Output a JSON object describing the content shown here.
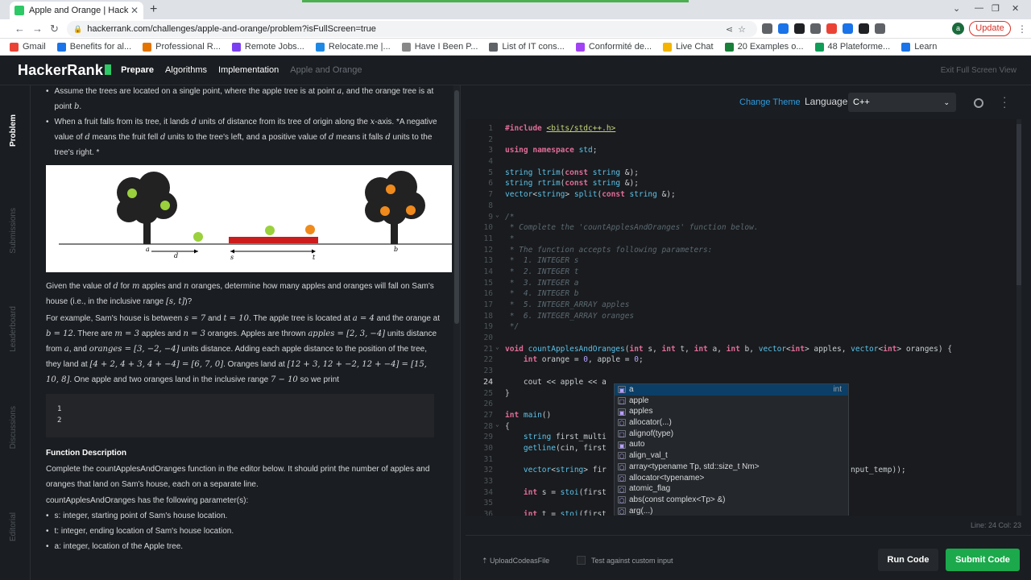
{
  "browser": {
    "tab_title": "Apple and Orange | HackerRank",
    "tab_title_shown": "Apple and Orange | Hack",
    "url": "hackerrank.com/challenges/apple-and-orange/problem?isFullScreen=true",
    "update_label": "Update",
    "avatar_letter": "a",
    "bookmarks": [
      "Gmail",
      "Benefits for al...",
      "Professional R...",
      "Remote Jobs...",
      "Relocate.me |...",
      "Have I Been P...",
      "List of IT cons...",
      "Conformité de...",
      "Live Chat",
      "20 Examples o...",
      "48 Plateforme...",
      "Learn"
    ],
    "bookmark_colors": [
      "#ea4335",
      "#1a73e8",
      "#e37400",
      "#7b3ff2",
      "#1e88e5",
      "#888888",
      "#5f6368",
      "#a142f4",
      "#f4b400",
      "#188038",
      "#0f9d58",
      "#1a73e8"
    ]
  },
  "header": {
    "logo": "HackerRank",
    "breadcrumb": [
      "Prepare",
      "Algorithms",
      "Implementation",
      "Apple and Orange"
    ],
    "exit_fullscreen": "Exit Full Screen View"
  },
  "sidebar_tabs": [
    "Problem",
    "Submissions",
    "Leaderboard",
    "Discussions",
    "Editorial"
  ],
  "problem": {
    "bullet1": [
      "Assume the trees are located on a single point, where the apple tree is at point ",
      "a",
      ", and the orange tree is at point ",
      "b",
      "."
    ],
    "bullet2": [
      "When a fruit falls from its tree, it lands ",
      "d",
      " units of distance from its tree of origin along the ",
      "x",
      "-axis. *A negative value of ",
      "d",
      " means the fruit fell ",
      "d",
      " units to the tree's left, and a positive value of ",
      "d",
      " means it falls ",
      "d",
      " units to the tree's right. *"
    ],
    "figure_labels": [
      "a",
      "d",
      "s",
      "t",
      "b"
    ],
    "para1": [
      "Given the value of ",
      "d",
      " for ",
      "m",
      " apples and ",
      "n",
      " oranges, determine how many apples and oranges will fall on Sam's house (i.e., in the inclusive range ",
      "[s, t]",
      ")?"
    ],
    "para2": [
      "For example, Sam's house is between ",
      "s = 7",
      " and ",
      "t = 10",
      ". The apple tree is located at ",
      "a = 4",
      " and the orange at ",
      "b = 12",
      ". There are ",
      "m = 3",
      " apples and ",
      "n = 3",
      " oranges. Apples are thrown ",
      "apples = [2, 3, −4]",
      " units distance from ",
      "a",
      ", and ",
      "oranges = [3, −2, −4]",
      " units distance. Adding each apple distance to the position of the tree, they land at ",
      "[4 + 2, 4 + 3, 4 + −4] = [6, 7, 0]",
      ". Oranges land at ",
      "[12 + 3, 12 + −2, 12 + −4] = [15, 10, 8]",
      ". One apple and two oranges land in the inclusive range ",
      "7 − 10",
      " so we print"
    ],
    "output_lines": [
      "1",
      "2"
    ],
    "func_desc_title": "Function Description",
    "func_desc": "Complete the countApplesAndOranges function in the editor below. It should print the number of apples and oranges that land on Sam's house, each on a separate line.",
    "params_intro": "countApplesAndOranges has the following parameter(s):",
    "params": [
      "s: integer, starting point of Sam's house location.",
      "t: integer, ending location of Sam's house location.",
      "a: integer, location of the Apple tree."
    ]
  },
  "editor": {
    "change_theme": "Change Theme",
    "language_label": "Language",
    "language": "C++",
    "current_line": "24",
    "status": "Line: 24 Col: 23",
    "lines": [
      "#include <bits/stdc++.h>",
      "",
      "using namespace std;",
      "",
      "string ltrim(const string &);",
      "string rtrim(const string &);",
      "vector<string> split(const string &);",
      "",
      "/*",
      " * Complete the 'countApplesAndOranges' function below.",
      " *",
      " * The function accepts following parameters:",
      " *  1. INTEGER s",
      " *  2. INTEGER t",
      " *  3. INTEGER a",
      " *  4. INTEGER b",
      " *  5. INTEGER_ARRAY apples",
      " *  6. INTEGER_ARRAY oranges",
      " */",
      "",
      "void countApplesAndOranges(int s, int t, int a, int b, vector<int> apples, vector<int> oranges) {",
      "    int orange = 0, apple = 0;",
      "",
      "    cout << apple << a",
      "}",
      "",
      "int main()",
      "{",
      "    string first_multi",
      "    getline(cin, first",
      "",
      "    vector<string> fir",
      "",
      "    int s = stoi(first",
      "",
      "    int t = stoi(first_"
    ],
    "line_tail_32": "nput_temp));"
  },
  "autocomplete": {
    "items": [
      {
        "label": "a",
        "type": "int"
      },
      {
        "label": "apple",
        "type": ""
      },
      {
        "label": "apples",
        "type": ""
      },
      {
        "label": "allocator(...)",
        "type": ""
      },
      {
        "label": "alignof(type)",
        "type": ""
      },
      {
        "label": "auto",
        "type": ""
      },
      {
        "label": "align_val_t",
        "type": ""
      },
      {
        "label": "array<typename Tp, std::size_t Nm>",
        "type": ""
      },
      {
        "label": "allocator<typename>",
        "type": ""
      },
      {
        "label": "atomic_flag",
        "type": ""
      },
      {
        "label": "abs(const complex<Tp> &)",
        "type": ""
      },
      {
        "label": "arg(...)",
        "type": ""
      }
    ]
  },
  "bottom": {
    "upload": "UploadCodeasFile",
    "custom_input": "Test against custom input",
    "run": "Run Code",
    "submit": "Submit Code"
  }
}
